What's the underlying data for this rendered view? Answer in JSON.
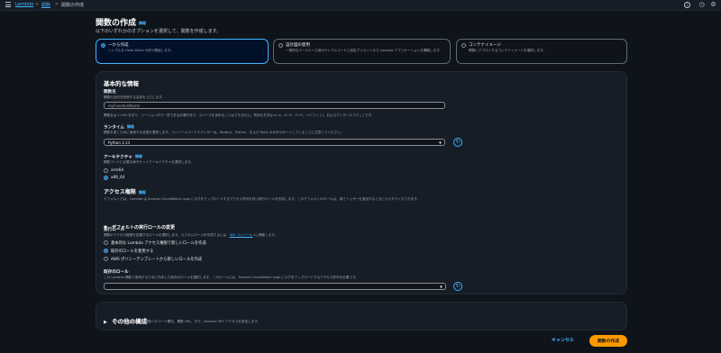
{
  "breadcrumb": {
    "items": [
      "Lambda",
      "関数",
      "関数の作成"
    ],
    "sep": ">"
  },
  "topbar": {
    "icons": [
      "menu-icon",
      "info-icon",
      "clock-icon",
      "settings-icon"
    ],
    "info_glyph": "i",
    "clock_glyph": "◷",
    "settings_glyph": "⚙"
  },
  "header": {
    "title": "関数の作成",
    "info": "情報",
    "subtitle": "以下のいずれかのオプションを選択して、関数を作成します。"
  },
  "options": [
    {
      "title": "一から作成",
      "desc": "シンプルな Hello World の例で開始します。"
    },
    {
      "title": "設計図の使用",
      "desc": "一般的なユースケース用のサンプルコードと設定プリセットから Lambda アプリケーションを構築します。"
    },
    {
      "title": "コンテナイメージ",
      "desc": "関数にデプロイするコンテナイメージを選択します。"
    }
  ],
  "basic": {
    "heading": "基本的な情報",
    "fn_name_label": "関数名",
    "fn_name_desc": "関数の目的を説明する名前を入力します。",
    "fn_name_value": "myFunctionName",
    "fn_name_hint": "関数名は 1～64 文字で、リージョン内で一意である必要があり、スペースを含めることはできません。有効な文字は a～z、A～Z、0～9、ハイフン (-)、およびアンダースコア (_) です。",
    "runtime_label": "ランタイム",
    "runtime_info": "情報",
    "runtime_desc": "関数を書くために使用する言語を選択します。コンソールコードエディターは、Node.js、Python、および Ruby のみをサポートしていることに注意してください。",
    "runtime_value": "Python 3.13",
    "arch_label": "アーキテクチャ",
    "arch_info": "情報",
    "arch_desc": "関数コードに必要な命令セットアーキテクチャを選択します。",
    "arch_options": [
      "arm64",
      "x86_64"
    ],
    "perm_heading": "アクセス権限",
    "perm_info": "情報",
    "perm_desc": "デフォルトでは、Lambda は Amazon CloudWatch Logs にログをアップロードするアクセス許可を持つ実行ロールを作成します。このデフォルトのロールは、後でトリガーを追加するときにカスタマイズできます。",
    "role_section": "デフォルトの実行ロールの変更",
    "exec_role_label": "実行ロール",
    "exec_role_desc": "関数のアクセス権限を定義するロールを選択します。カスタムロールを作成するには、",
    "iam_link": "IAM コンソール",
    "exec_role_desc_end": "に移動します。",
    "role_options": [
      "基本的な Lambda アクセス権限で新しいロールを作成",
      "既存のロールを使用する",
      "AWS ポリシーテンプレートから新しいロールを作成"
    ],
    "existing_label": "既存のロール",
    "existing_desc": "この Lambda 関数で使用するために作成した既存のロールを選択します。このロールには、Amazon CloudWatch Logs にログをアップロードするアクセス許可が必要です。",
    "existing_value": ""
  },
  "other": {
    "heading": "その他の構成",
    "desc": "追加設定を使用して、関数へのコード署名、関数 URL、タグ、Amazon VPC アクセスを設定します。"
  },
  "footer": {
    "cancel": "キャンセル",
    "create": "関数の作成"
  },
  "colors": {
    "accent": "#42b4ff",
    "primary_button": "#ff9900",
    "background": "#0f141a",
    "panel": "#161d26"
  }
}
